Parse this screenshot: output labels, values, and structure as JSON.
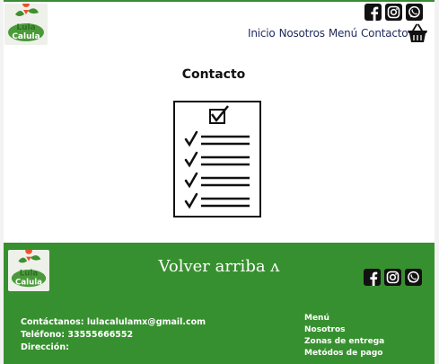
{
  "header": {
    "logo_text": "Lula Calula",
    "nav": [
      "Inicio",
      "Nosotros",
      "Menú",
      "Contacto"
    ],
    "social_icons": [
      "facebook-icon",
      "instagram-icon",
      "whatsapp-icon"
    ],
    "cart_icon": "basket-icon"
  },
  "main": {
    "title": "Contacto",
    "illustration_icon": "checklist-icon"
  },
  "footer": {
    "back_to_top": "Volver arriba ʌ",
    "contact_line": "Contáctanos: lulacalulamx@gmail.com",
    "phone_line": "Teléfono: 33555666552",
    "address_line": "Dirección:",
    "links": [
      "Menú",
      "Nosotros",
      "Zonas de entrega",
      "Metódos de pago"
    ]
  },
  "colors": {
    "brand_green": "#37902f",
    "nav_text": "#1f2a5c",
    "icon_black": "#111111",
    "logo_orange": "#e8542a"
  }
}
